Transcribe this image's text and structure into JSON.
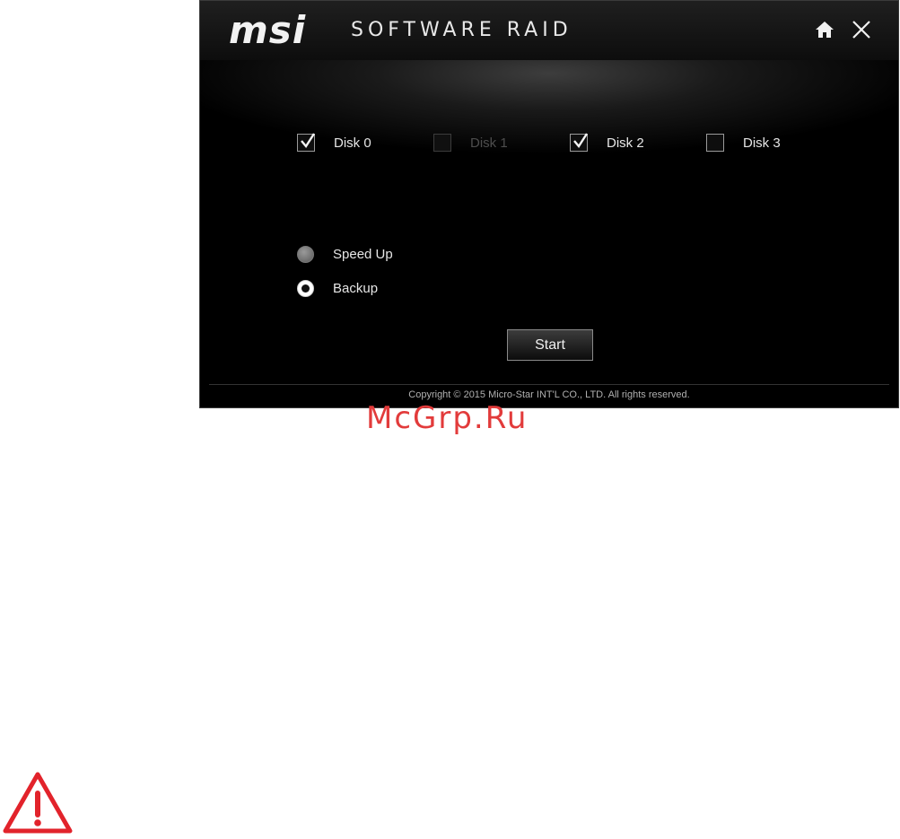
{
  "window": {
    "brand": "msi",
    "title": "SOFTWARE RAID",
    "home_icon": "home-icon",
    "close_icon": "close-icon"
  },
  "disks": [
    {
      "label": "Disk 0",
      "checked": true,
      "enabled": true
    },
    {
      "label": "Disk 1",
      "checked": false,
      "enabled": false
    },
    {
      "label": "Disk 2",
      "checked": true,
      "enabled": true
    },
    {
      "label": "Disk 3",
      "checked": false,
      "enabled": true
    }
  ],
  "modes": [
    {
      "label": "Speed Up",
      "selected": false
    },
    {
      "label": "Backup",
      "selected": true
    }
  ],
  "start_label": "Start",
  "copyright": "Copyright © 2015 Micro-Star INT'L CO., LTD. All rights reserved.",
  "watermark": "McGrp.Ru",
  "warning_icon": "warning-triangle-icon",
  "colors": {
    "background": "#000000",
    "text": "#e6e6e6",
    "disabled_text": "#4d4d4d",
    "watermark": "#e23b3b",
    "warning": "#e2232b"
  }
}
